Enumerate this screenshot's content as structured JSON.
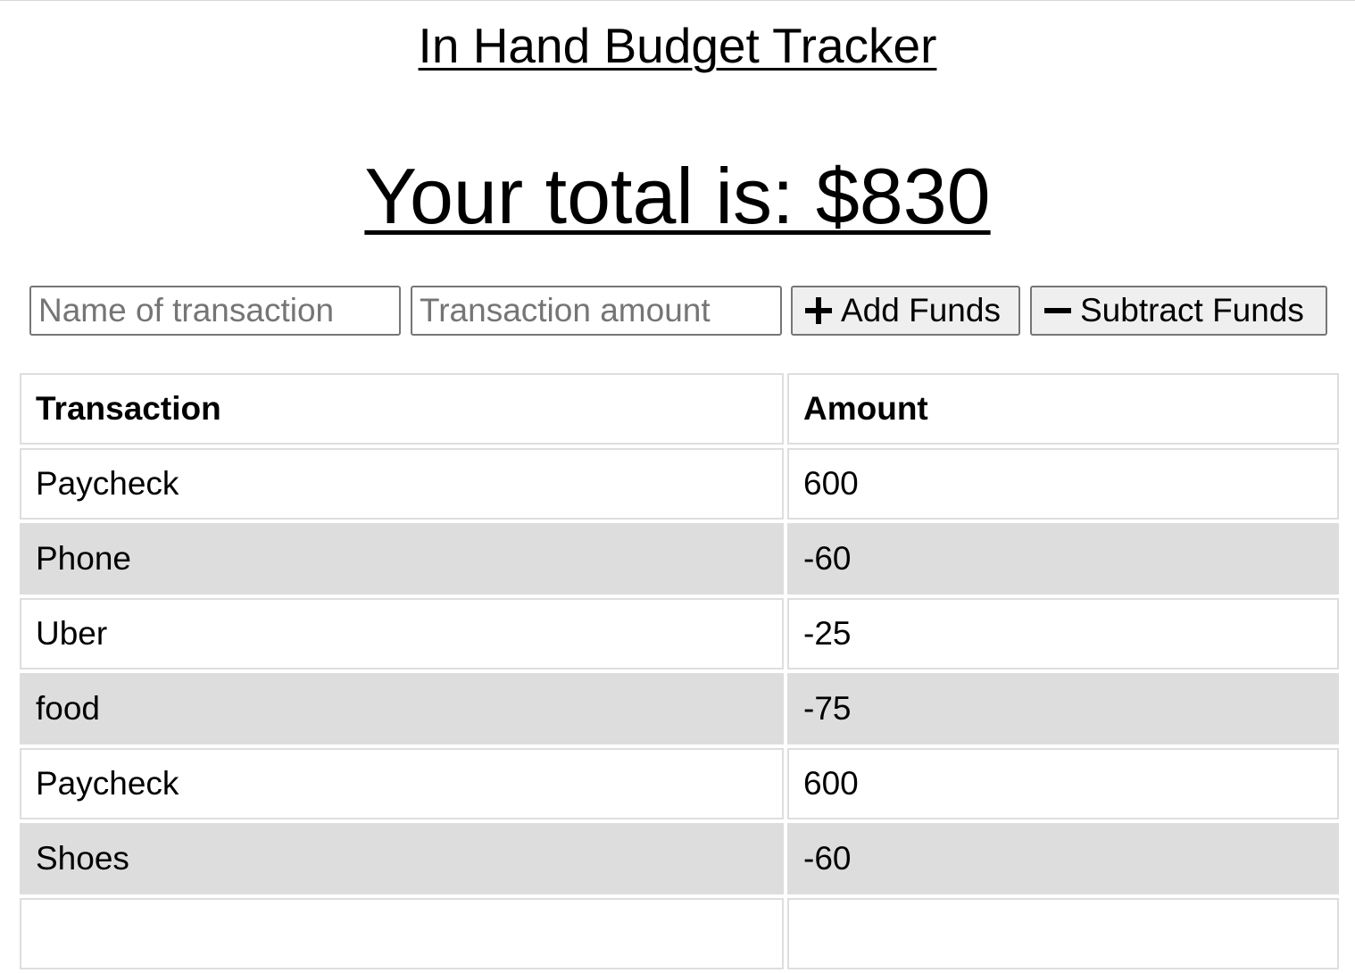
{
  "app": {
    "title": "In Hand Budget Tracker"
  },
  "total": {
    "label": "Your total is: $830"
  },
  "form": {
    "name_placeholder": "Name of transaction",
    "amount_placeholder": "Transaction amount",
    "add_label": "Add Funds",
    "subtract_label": "Subtract Funds",
    "add_icon": "plus-icon",
    "subtract_icon": "minus-icon"
  },
  "table": {
    "headers": [
      "Transaction",
      "Amount"
    ],
    "rows": [
      {
        "name": "Paycheck",
        "amount": "600"
      },
      {
        "name": "Phone",
        "amount": "-60"
      },
      {
        "name": "Uber",
        "amount": "-25"
      },
      {
        "name": "food",
        "amount": "-75"
      },
      {
        "name": "Paycheck",
        "amount": "600"
      },
      {
        "name": "Shoes",
        "amount": "-60"
      }
    ],
    "stripe_color": "#dddddd"
  }
}
